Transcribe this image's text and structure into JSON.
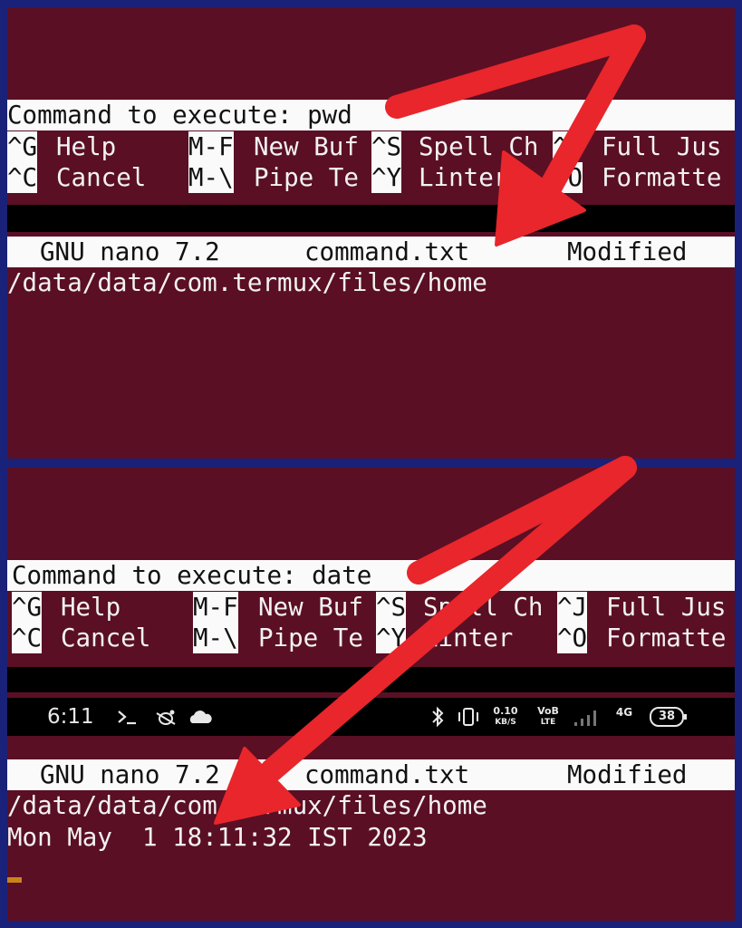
{
  "top_panel": {
    "prompt": "Command to execute: pwd",
    "shortcuts_row1": [
      {
        "key": "^G",
        "label": "Help"
      },
      {
        "key": "M-F",
        "label": "New Buf"
      },
      {
        "key": "^S",
        "label": "Spell Ch"
      },
      {
        "key": "^",
        "label": "Full Jus"
      }
    ],
    "shortcuts_row2": [
      {
        "key": "^C",
        "label": "Cancel"
      },
      {
        "key": "M-\\",
        "label": "Pipe Te"
      },
      {
        "key": "^Y",
        "label": "Linter"
      },
      {
        "key": "^O",
        "label": "Formatte"
      }
    ],
    "title_bar": {
      "app": "GNU nano 7.2",
      "file": "command.txt",
      "state": "Modified"
    },
    "output_lines": [
      "/data/data/com.termux/files/home"
    ]
  },
  "bottom_panel": {
    "prompt": "Command to execute: date",
    "shortcuts_row1": [
      {
        "key": "^G",
        "label": "Help"
      },
      {
        "key": "M-F",
        "label": "New Buf"
      },
      {
        "key": "^S",
        "label": "Spell Ch"
      },
      {
        "key": "^J",
        "label": "Full Jus"
      }
    ],
    "shortcuts_row2": [
      {
        "key": "^C",
        "label": "Cancel"
      },
      {
        "key": "M-\\",
        "label": "Pipe Te"
      },
      {
        "key": "^Y",
        "label": "Linter"
      },
      {
        "key": "^O",
        "label": "Formatte"
      }
    ],
    "status_bar": {
      "time": "6:11",
      "speed_value": "0.10",
      "speed_unit": "KB/S",
      "volte_top": "VoB",
      "volte_bottom": "LTE",
      "network": "4G",
      "battery": "38"
    },
    "title_bar": {
      "app": "GNU nano 7.2",
      "file": "command.txt",
      "state": "Modified"
    },
    "output_lines": [
      "/data/data/com.termux/files/home",
      "Mon May  1 18:11:32 IST 2023"
    ]
  },
  "colors": {
    "terminal_bg": "#5a0f24",
    "frame": "#1a2178",
    "arrow": "#e8262b",
    "cursor": "#c8841a"
  },
  "icons": [
    "terminal-icon",
    "bug-icon",
    "cloud-icon",
    "bluetooth-icon",
    "vibrate-icon",
    "signal-icon",
    "battery-icon",
    "arrow-annotation-icon"
  ]
}
